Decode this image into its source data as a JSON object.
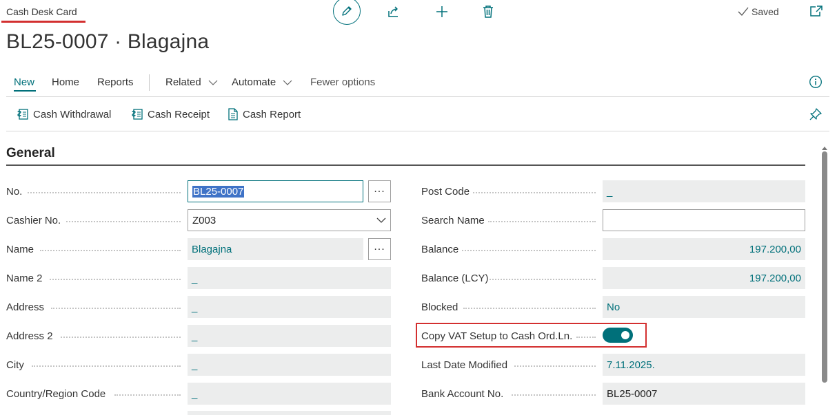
{
  "header": {
    "caption": "Cash Desk Card",
    "title": "BL25-0007 · Blagajna",
    "saved_label": "Saved"
  },
  "toolbar": {
    "edit_icon": "pencil-icon",
    "share_icon": "share-icon",
    "add_icon": "plus-icon",
    "delete_icon": "trash-icon",
    "open_new_icon": "open-in-new-window-icon"
  },
  "menu": {
    "new": "New",
    "home": "Home",
    "reports": "Reports",
    "related": "Related",
    "automate": "Automate",
    "fewer": "Fewer options"
  },
  "actions": {
    "cash_withdrawal": "Cash Withdrawal",
    "cash_receipt": "Cash Receipt",
    "cash_report": "Cash Report"
  },
  "section": {
    "title": "General"
  },
  "left_fields": {
    "no": {
      "label": "No.",
      "value": "BL25-0007"
    },
    "cashier": {
      "label": "Cashier No.",
      "value": "Z003"
    },
    "name": {
      "label": "Name",
      "value": "Blagajna"
    },
    "name2": {
      "label": "Name 2",
      "value": "_"
    },
    "address": {
      "label": "Address",
      "value": "_"
    },
    "address2": {
      "label": "Address 2",
      "value": "_"
    },
    "city": {
      "label": "City",
      "value": "_"
    },
    "country": {
      "label": "Country/Region Code",
      "value": "_"
    }
  },
  "right_fields": {
    "post_code": {
      "label": "Post Code",
      "value": "_"
    },
    "search_name": {
      "label": "Search Name",
      "value": ""
    },
    "balance": {
      "label": "Balance",
      "value": "197.200,00"
    },
    "balance_lcy": {
      "label": "Balance (LCY)",
      "value": "197.200,00"
    },
    "blocked": {
      "label": "Blocked",
      "value": "No"
    },
    "copy_vat": {
      "label": "Copy VAT Setup to Cash Ord.Ln.",
      "value": true
    },
    "last_modified": {
      "label": "Last Date Modified",
      "value": "7.11.2025."
    },
    "bank_account": {
      "label": "Bank Account No.",
      "value": "BL25-0007"
    }
  },
  "colors": {
    "accent": "#00707a",
    "highlight": "#d32f2f"
  }
}
